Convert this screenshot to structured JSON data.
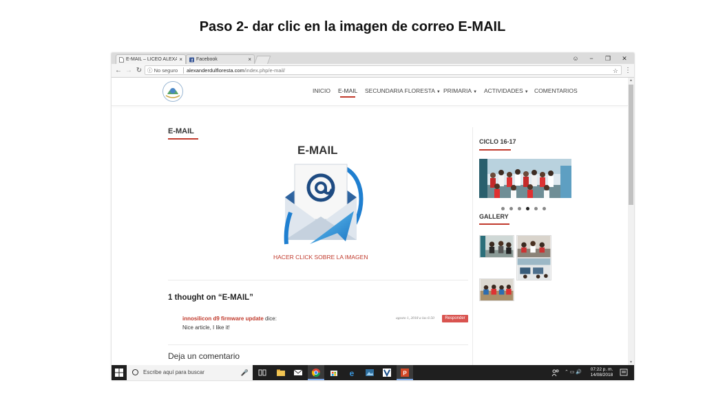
{
  "slide": {
    "title": "Paso 2- dar clic en la imagen de correo E-MAIL"
  },
  "browser": {
    "tabs": [
      {
        "label": "E-MAIL – LICEO ALEXANDER",
        "close": "×",
        "icon": "page-icon"
      },
      {
        "label": "Facebook",
        "close": "×",
        "icon": "facebook-icon"
      }
    ],
    "window_controls": {
      "profile": "☺",
      "minimize": "−",
      "maximize": "❐",
      "close": "✕"
    },
    "nav": {
      "back": "←",
      "forward": "→",
      "reload": "↻"
    },
    "security_label": "No seguro",
    "url_host": "alexanderdulfloresta.com",
    "url_path": "/index.php/e-mail/",
    "bookmark": "☆",
    "menu": "⋮"
  },
  "site": {
    "nav": [
      {
        "label": "INICIO",
        "caret": ""
      },
      {
        "label": "E-MAIL",
        "caret": ""
      },
      {
        "label": "SECUNDARIA FLORESTA",
        "caret": "▼"
      },
      {
        "label": "PRIMARIA",
        "caret": "▼"
      },
      {
        "label": "ACTIVIDADES",
        "caret": "▼"
      },
      {
        "label": "COMENTARIOS",
        "caret": ""
      }
    ],
    "accent": "#c0392b"
  },
  "main": {
    "page_title": "E-MAIL",
    "image_title": "E-MAIL",
    "click_link": "HACER CLICK SOBRE LA IMAGEN",
    "comments_heading": "1 thought on “E-MAIL”",
    "comment": {
      "author": "innosilicon d9 firmware update",
      "says": " dice:",
      "date": "agosto 1, 2018 a las 6:50",
      "reply": "Responder",
      "text": "Nice article, I like it!"
    },
    "leave_comment": "Deja un comentario"
  },
  "sidebar": {
    "cycle_heading": "CICLO 16-17",
    "gallery_heading": "GALLERY",
    "slider_dots": 6,
    "slider_active": 4
  },
  "taskbar": {
    "search_placeholder": "Escribe aquí para buscar",
    "mic": "🎤",
    "time": "07:22 p. m.",
    "date": "14/08/2018",
    "tray": "⌃  ▭  🔊"
  }
}
